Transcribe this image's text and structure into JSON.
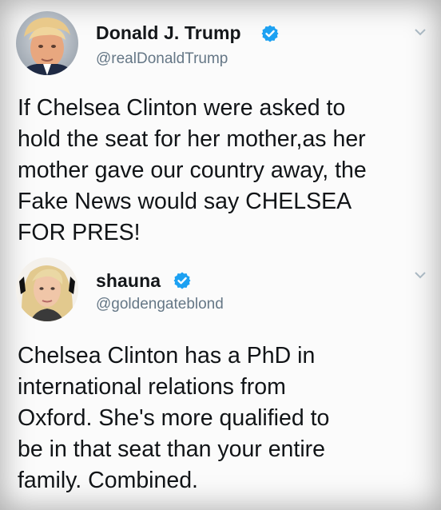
{
  "tweets": [
    {
      "display_name": "Donald J. Trump",
      "handle": "@realDonaldTrump",
      "verified": true,
      "menu_icon": "chevron-down-icon",
      "lines": [
        "If Chelsea Clinton were asked to",
        "hold the seat for her mother,as her",
        "mother gave our country away, the",
        "Fake News would say CHELSEA",
        "FOR PRES!"
      ]
    },
    {
      "display_name": "shauna",
      "handle": "@goldengateblond",
      "verified": true,
      "menu_icon": "chevron-down-icon",
      "lines": [
        "Chelsea Clinton has a PhD in",
        "international relations from",
        "Oxford. She's more qualified to",
        "be in that seat than your entire",
        "family. Combined."
      ]
    }
  ],
  "colors": {
    "verified_blue": "#1da1f2",
    "handle_gray": "#657786",
    "text_dark": "#14171a"
  }
}
